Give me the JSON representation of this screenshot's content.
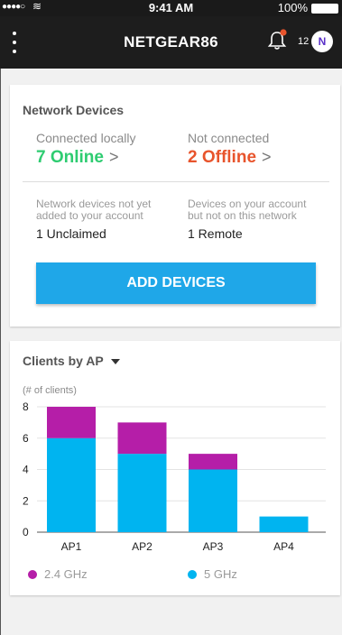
{
  "status_bar": {
    "time": "9:41 AM",
    "battery": "100%"
  },
  "header": {
    "title": "NETGEAR86",
    "notification_count": "12",
    "avatar_initial": "N"
  },
  "network_devices": {
    "title": "Network Devices",
    "connected": {
      "label": "Connected locally",
      "value": "7 Online"
    },
    "not_connected": {
      "label": "Not connected",
      "value": "2 Offline"
    },
    "unclaimed": {
      "label_line1": "Network devices not yet",
      "label_line2": "added to your account",
      "value": "1 Unclaimed"
    },
    "remote": {
      "label_line1": "Devices on your account",
      "label_line2": "but not on this network",
      "value": "1 Remote"
    },
    "add_button": "ADD DEVICES"
  },
  "colors": {
    "online": "#2ecc71",
    "offline": "#e8542c",
    "accent": "#1fa7e8",
    "ghz24": "#b51ea8",
    "ghz5": "#00b4f0"
  },
  "clients": {
    "dropdown_label": "Clients by AP",
    "ylabel": "(# of clients)"
  },
  "chart_data": {
    "type": "bar",
    "stacked": true,
    "categories": [
      "AP1",
      "AP2",
      "AP3",
      "AP4"
    ],
    "series": [
      {
        "name": "5 GHz",
        "values": [
          6,
          5,
          4,
          1
        ]
      },
      {
        "name": "2.4 GHz",
        "values": [
          2,
          2,
          1,
          0
        ]
      }
    ],
    "ylabel": "(# of clients)",
    "ylim": [
      0,
      8
    ],
    "yticks": [
      0,
      2,
      4,
      6,
      8
    ],
    "grid": true,
    "legend": "bottom"
  }
}
